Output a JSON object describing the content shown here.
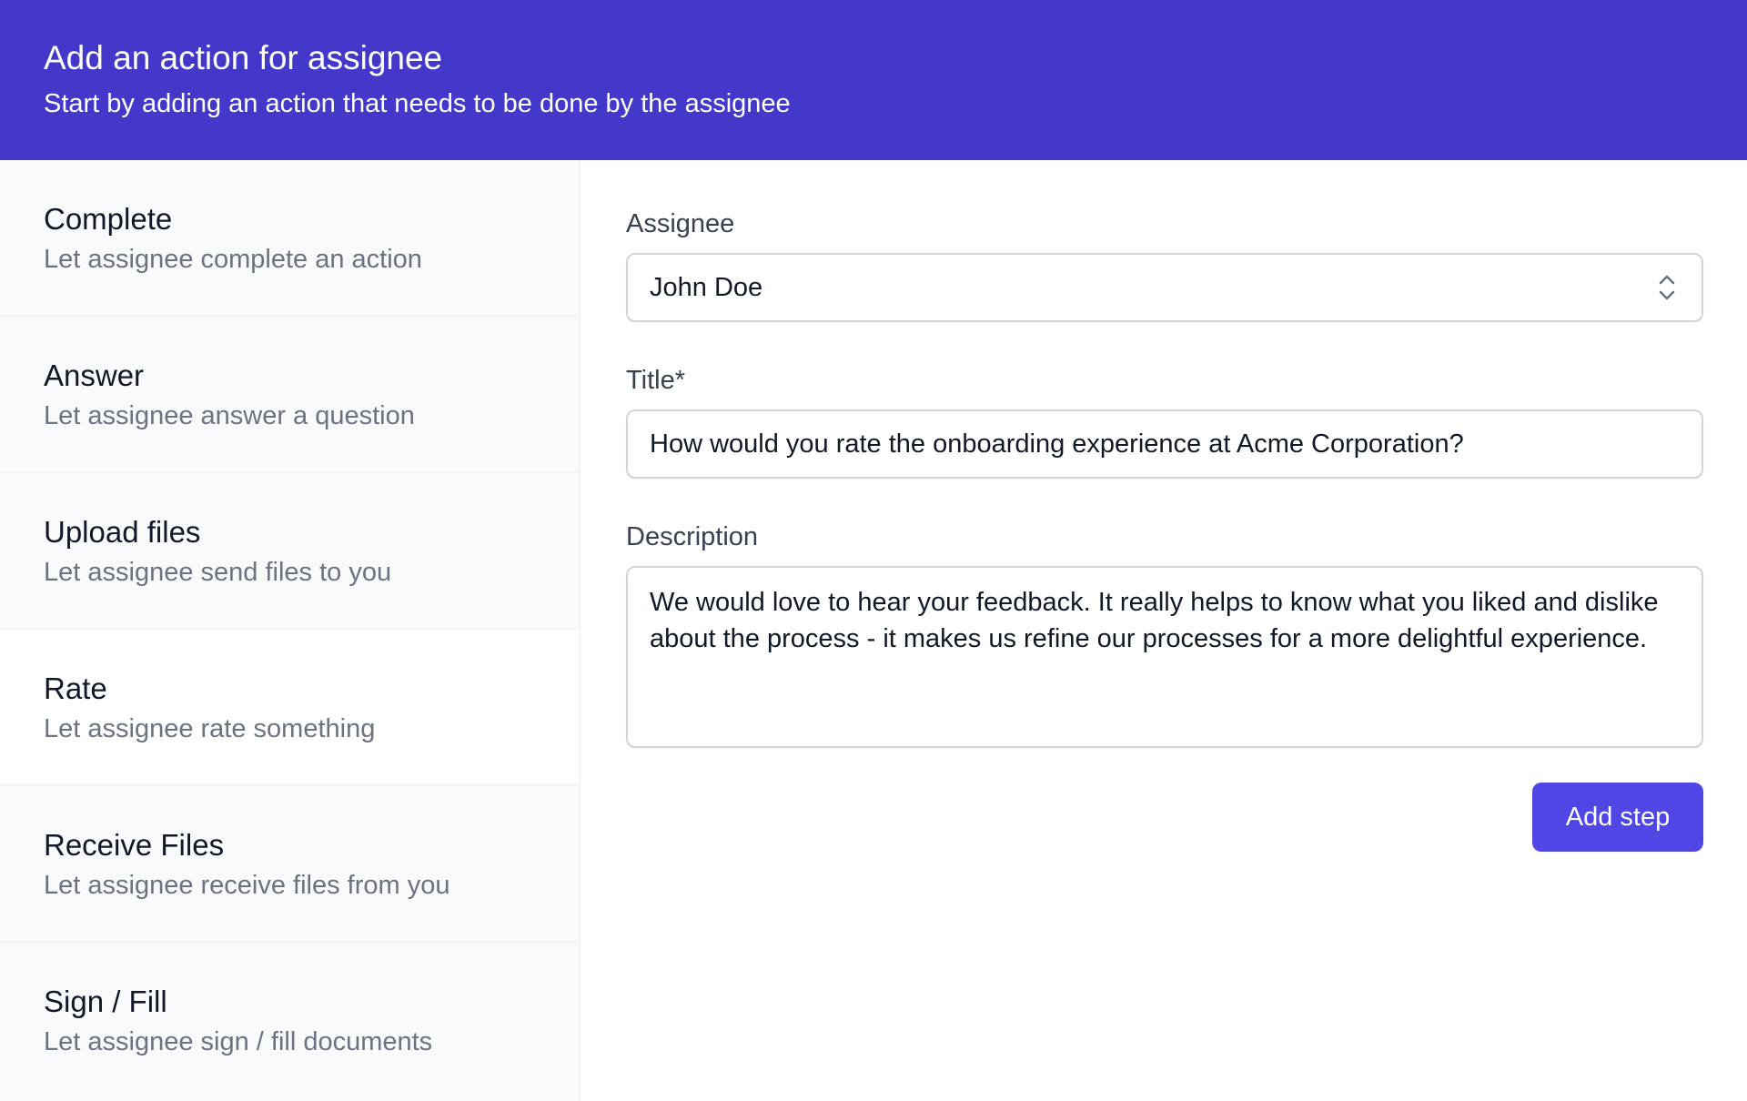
{
  "header": {
    "title": "Add an action for assignee",
    "subtitle": "Start by adding an action that needs to be done by the assignee"
  },
  "sidebar": {
    "selected_index": 3,
    "options": [
      {
        "title": "Complete",
        "description": "Let assignee complete an action"
      },
      {
        "title": "Answer",
        "description": "Let assignee answer a question"
      },
      {
        "title": "Upload files",
        "description": "Let assignee send files to you"
      },
      {
        "title": "Rate",
        "description": "Let assignee rate something"
      },
      {
        "title": "Receive Files",
        "description": "Let assignee receive files from you"
      },
      {
        "title": "Sign / Fill",
        "description": "Let assignee sign / fill documents"
      }
    ]
  },
  "form": {
    "assignee": {
      "label": "Assignee",
      "value": "John Doe",
      "icon": "chevron-up-down-icon"
    },
    "title": {
      "label": "Title*",
      "value": "How would you rate the onboarding experience at Acme Corporation?"
    },
    "description": {
      "label": "Description",
      "value": "We would love to hear your feedback. It really helps to know what you liked and dislike about the process - it makes us refine our processes for a more delightful experience."
    },
    "submit_label": "Add step"
  },
  "colors": {
    "header_bg": "#4338ca",
    "primary_button": "#4f46e5",
    "sidebar_bg": "#f9fafb",
    "selected_bg": "#ffffff"
  }
}
